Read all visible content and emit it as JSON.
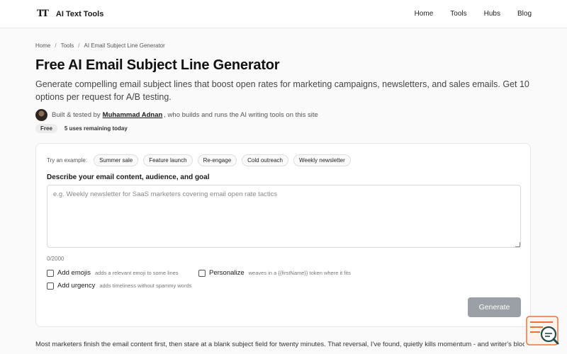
{
  "header": {
    "logo_icon": "TT",
    "logo_text": "AI Text Tools",
    "nav": [
      "Home",
      "Tools",
      "Hubs",
      "Blog"
    ]
  },
  "breadcrumb": [
    "Home",
    "Tools",
    "AI Email Subject Line Generator"
  ],
  "breadcrumb_sep": "/",
  "page": {
    "title": "Free AI Email Subject Line Generator",
    "subtitle": "Generate compelling email subject lines that boost open rates for marketing campaigns, newsletters, and sales emails. Get 10 options per request for A/B testing."
  },
  "author": {
    "prefix": "Built & tested by",
    "name": "Muhammad Adnan",
    "suffix": ", who builds and runs the AI writing tools on this site"
  },
  "badges": {
    "free": "Free",
    "uses": "5 uses remaining today"
  },
  "form": {
    "examples_label": "Try an example:",
    "examples": [
      "Summer sale",
      "Feature launch",
      "Re-engage",
      "Cold outreach",
      "Weekly newsletter"
    ],
    "field_label": "Describe your email content, audience, and goal",
    "placeholder": "e.g. Weekly newsletter for SaaS marketers covering email open rate tactics",
    "value": "",
    "counter": "0/2000",
    "options": [
      {
        "name": "Add emojis",
        "hint": "adds a relevant emoji to some lines",
        "checked": false
      },
      {
        "name": "Personalize",
        "hint": "weaves in a {{firstName}} token where it fits",
        "checked": false
      },
      {
        "name": "Add urgency",
        "hint": "adds timeliness without spammy words",
        "checked": false
      }
    ],
    "generate_label": "Generate"
  },
  "body_text": "Most marketers finish the email content first, then stare at a blank subject field for twenty minutes. That reversal, I've found, quietly kills momentum - and writer's block",
  "icons": {
    "avatar": "author-avatar",
    "corner": "search-chat-icon"
  },
  "colors": {
    "generate_button": "#9aa0a6",
    "corner_accent": "#e8743b",
    "corner_dark": "#1f4d4a"
  }
}
